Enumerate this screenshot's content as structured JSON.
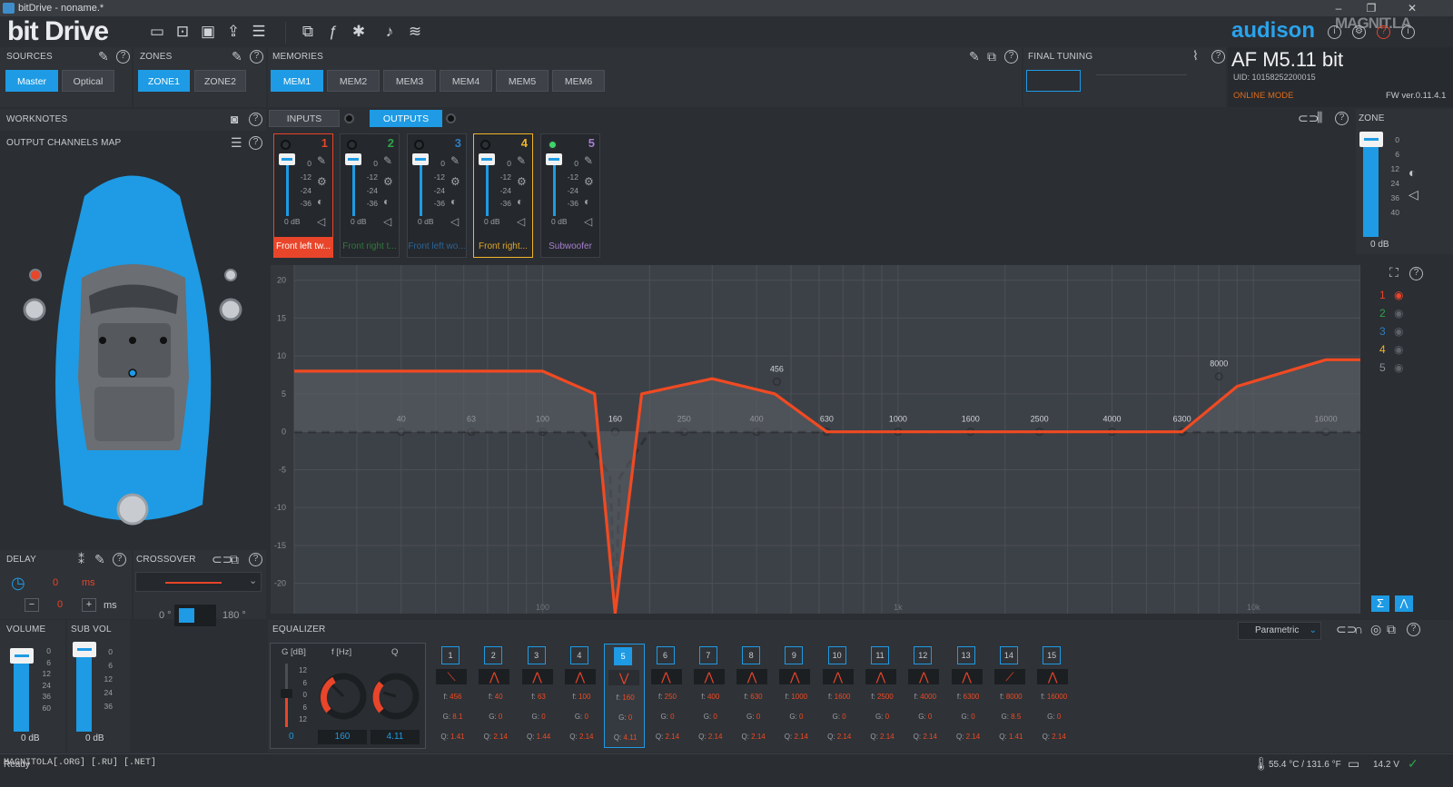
{
  "titlebar": {
    "title": "bitDrive - noname.*",
    "minimize": "–",
    "restore": "❐",
    "close": "✕"
  },
  "app": {
    "logo": "bit Drive",
    "brand": "audison",
    "watermark": "MAGNIT.LA"
  },
  "device": {
    "name": "AF M5.11 bit",
    "uid": "UID: 10158252200015",
    "mode": "ONLINE MODE",
    "fw": "FW ver.0.11.4.1"
  },
  "sources": {
    "header": "SOURCES",
    "buttons": [
      {
        "label": "Master",
        "active": true
      },
      {
        "label": "Optical",
        "active": false
      }
    ]
  },
  "zones": {
    "header": "ZONES",
    "buttons": [
      {
        "label": "ZONE1",
        "active": true
      },
      {
        "label": "ZONE2",
        "active": false
      }
    ]
  },
  "memories": {
    "header": "MEMORIES",
    "buttons": [
      {
        "label": "MEM1",
        "active": true
      },
      {
        "label": "MEM2"
      },
      {
        "label": "MEM3"
      },
      {
        "label": "MEM4"
      },
      {
        "label": "MEM5"
      },
      {
        "label": "MEM6"
      }
    ]
  },
  "final_tuning": {
    "header": "FINAL TUNING"
  },
  "worknotes": {
    "header": "WORKNOTES"
  },
  "io_tabs": {
    "inputs": "INPUTS",
    "outputs": "OUTPUTS"
  },
  "output_map": {
    "header": "OUTPUT CHANNELS MAP"
  },
  "channels": [
    {
      "num": "1",
      "label": "Front left tw...",
      "color": "#e8452a",
      "label_bg": "#e8452a",
      "label_fg": "#ffffff",
      "on": false,
      "db": "0 dB"
    },
    {
      "num": "2",
      "label": "Front right t...",
      "color": "#2fa34a",
      "label_bg": "#25282c",
      "label_fg": "#2f7a3c",
      "on": false,
      "db": "0 dB"
    },
    {
      "num": "3",
      "label": "Front left wo...",
      "color": "#2e7ec3",
      "label_bg": "#25282c",
      "label_fg": "#2c6496",
      "on": false,
      "db": "0 dB"
    },
    {
      "num": "4",
      "label": "Front right...",
      "color": "#f0b429",
      "label_bg": "#25282c",
      "label_fg": "#e0a62a",
      "on": false,
      "db": "0 dB"
    },
    {
      "num": "5",
      "label": "Subwoofer",
      "color": "#a57fd0",
      "label_bg": "#25282c",
      "label_fg": "#a57fd0",
      "on": true,
      "db": "0 dB"
    }
  ],
  "fader_scale": [
    "0",
    "-12",
    "-24",
    "-36"
  ],
  "zone_panel": {
    "header": "ZONE",
    "value": "0 dB",
    "scale": [
      "0",
      "6",
      "12",
      "24",
      "36",
      "40"
    ]
  },
  "delay": {
    "header": "DELAY",
    "value_ms": "0",
    "unit_ms": "ms",
    "step_value": "0",
    "minus": "−",
    "plus": "+"
  },
  "crossover": {
    "header": "CROSSOVER",
    "phase0": "0 °",
    "phase180": "180 °"
  },
  "volume": {
    "header": "VOLUME",
    "value": "0 dB",
    "scale": [
      "0",
      "6",
      "12",
      "24",
      "36",
      "60"
    ]
  },
  "subvol": {
    "header": "SUB VOL",
    "value": "0 dB",
    "scale": [
      "0",
      "6",
      "12",
      "24",
      "36"
    ]
  },
  "graph": {
    "y_ticks": [
      "20",
      "15",
      "10",
      "5",
      "0",
      "-5",
      "-10",
      "-15",
      "-20"
    ],
    "x_ticks": [
      "100",
      "1k",
      "10k"
    ],
    "legend": [
      "1",
      "2",
      "3",
      "4",
      "5"
    ],
    "legend_colors": [
      "#e8452a",
      "#2fa34a",
      "#2e7ec3",
      "#f0b429",
      "#8e8e9a"
    ],
    "point_labels": [
      "40",
      "63",
      "100",
      "160",
      "250",
      "400",
      "630",
      "1000",
      "1600",
      "2500",
      "4000",
      "6300",
      "16000",
      "456",
      "8000"
    ]
  },
  "chart_data": {
    "type": "line",
    "title": "",
    "xlabel": "",
    "ylabel": "",
    "x_scale": "log",
    "xlim": [
      20,
      20000
    ],
    "ylim": [
      -24,
      22
    ],
    "series": [
      {
        "name": "",
        "points": [
          [
            20,
            8
          ],
          [
            100,
            8
          ],
          [
            140,
            5
          ],
          [
            160,
            -24
          ],
          [
            190,
            5
          ],
          [
            300,
            7
          ],
          [
            450,
            5
          ],
          [
            630,
            0
          ],
          [
            2500,
            0
          ],
          [
            6300,
            0
          ],
          [
            9000,
            6
          ],
          [
            16000,
            9.5
          ],
          [
            20000,
            9.5
          ]
        ]
      }
    ]
  },
  "equalizer": {
    "header": "EQUALIZER",
    "mode": "Parametric",
    "g_label": "G [dB]",
    "f_label": "f [Hz]",
    "q_label": "Q",
    "g_value": "0",
    "f_value": "160",
    "q_value": "4.11",
    "g_scale": [
      "12",
      "6",
      "0",
      "6",
      "12"
    ],
    "bands": [
      {
        "n": "1",
        "f": "456",
        "g": "8.1",
        "q": "1.41",
        "sym": "\\"
      },
      {
        "n": "2",
        "f": "40",
        "g": "0",
        "q": "2.14",
        "sym": "^"
      },
      {
        "n": "3",
        "f": "63",
        "g": "0",
        "q": "1.44",
        "sym": "^"
      },
      {
        "n": "4",
        "f": "100",
        "g": "0",
        "q": "2.14",
        "sym": "^"
      },
      {
        "n": "5",
        "f": "160",
        "g": "0",
        "q": "4.11",
        "sym": "v"
      },
      {
        "n": "6",
        "f": "250",
        "g": "0",
        "q": "2.14",
        "sym": "^"
      },
      {
        "n": "7",
        "f": "400",
        "g": "0",
        "q": "2.14",
        "sym": "^"
      },
      {
        "n": "8",
        "f": "630",
        "g": "0",
        "q": "2.14",
        "sym": "^"
      },
      {
        "n": "9",
        "f": "1000",
        "g": "0",
        "q": "2.14",
        "sym": "^"
      },
      {
        "n": "10",
        "f": "1600",
        "g": "0",
        "q": "2.14",
        "sym": "^"
      },
      {
        "n": "11",
        "f": "2500",
        "g": "0",
        "q": "2.14",
        "sym": "^"
      },
      {
        "n": "12",
        "f": "4000",
        "g": "0",
        "q": "2.14",
        "sym": "^"
      },
      {
        "n": "13",
        "f": "6300",
        "g": "0",
        "q": "2.14",
        "sym": "^"
      },
      {
        "n": "14",
        "f": "8000",
        "g": "8.5",
        "q": "1.41",
        "sym": "/"
      },
      {
        "n": "15",
        "f": "16000",
        "g": "0",
        "q": "2.14",
        "sym": "^"
      }
    ]
  },
  "status": {
    "left": "Ready",
    "watermark": "MAGNITOLA[.ORG] [.RU] [.NET]",
    "temp": "55.4 °C / 131.6 °F",
    "voltage": "14.2 V"
  },
  "colors": {
    "accent": "#1e9be4",
    "curve": "#f04a22"
  }
}
